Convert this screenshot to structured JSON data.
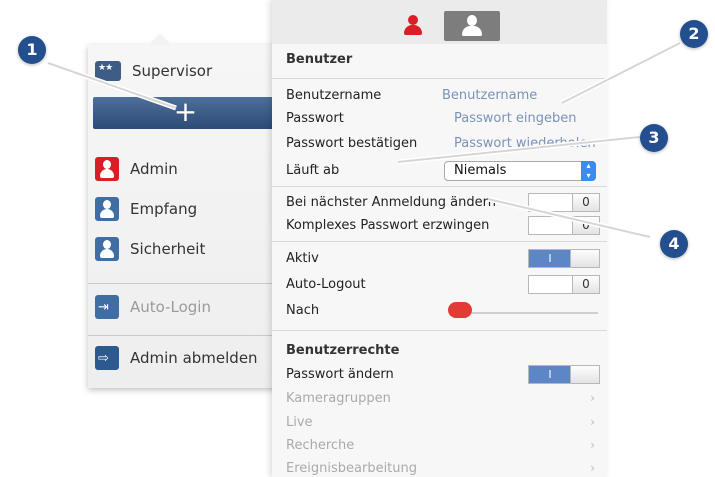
{
  "user_menu": {
    "supervisor_label": "Supervisor",
    "add_label": "+",
    "users": [
      {
        "label": "Admin",
        "color": "#d81f26"
      },
      {
        "label": "Empfang",
        "color": "#3f6ea3"
      },
      {
        "label": "Sicherheit",
        "color": "#3f6ea3"
      }
    ],
    "auto_login_label": "Auto-Login",
    "logout_label": "Admin abmelden"
  },
  "panel": {
    "section_user": "Benutzer",
    "fields": {
      "username_label": "Benutzername",
      "username_placeholder": "Benutzername",
      "password_label": "Passwort",
      "password_placeholder": "Passwort eingeben",
      "confirm_label": "Passwort bestätigen",
      "confirm_placeholder": "Passwort wiederholen",
      "expires_label": "Läuft ab",
      "expires_value": "Niemals",
      "next_login_label": "Bei nächster Anmeldung ändern",
      "next_login_state": "0",
      "complex_label": "Komplexes Passwort erzwingen",
      "complex_state": "0",
      "active_label": "Aktiv",
      "active_state": "I",
      "auto_logout_label": "Auto-Logout",
      "auto_logout_state": "0",
      "after_label": "Nach"
    },
    "section_rights": "Benutzerrechte",
    "rights": {
      "change_password_label": "Passwort ändern",
      "change_password_state": "I",
      "items": [
        "Kameragruppen",
        "Live",
        "Recherche",
        "Ereignisbearbeitung"
      ]
    }
  },
  "callouts": [
    "1",
    "2",
    "3",
    "4"
  ],
  "colors": {
    "accent": "#234f8f",
    "admin_red": "#d81f26",
    "toggle_on": "#5c86c6"
  }
}
